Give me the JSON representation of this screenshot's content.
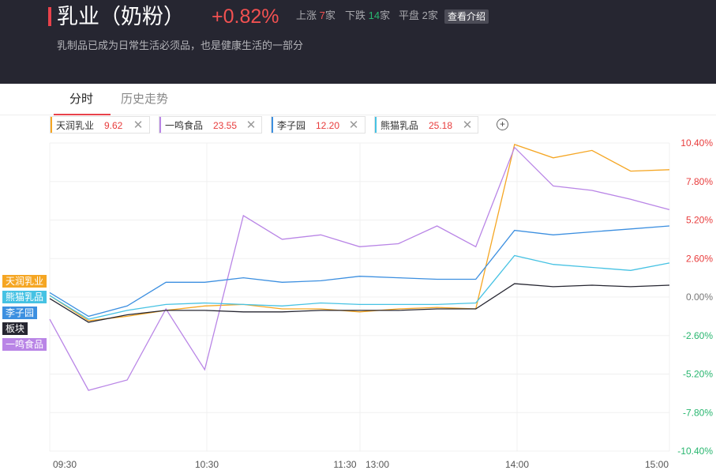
{
  "header": {
    "title": "乳业（奶粉）",
    "change": "+0.82%",
    "up_label": "上涨",
    "up_count": "7",
    "down_label": "下跌",
    "down_count": "14",
    "flat_label": "平盘",
    "flat_count": "2",
    "unit": "家",
    "intro_button": "查看介绍",
    "subtitle": "乳制品已成为日常生活必须品，也是健康生活的一部分"
  },
  "tabs": [
    {
      "label": "分时",
      "active": true
    },
    {
      "label": "历史走势",
      "active": false
    }
  ],
  "compare_chips": [
    {
      "name": "天润乳业",
      "price": "9.62",
      "color": "#f5a623"
    },
    {
      "name": "一鸣食品",
      "price": "23.55",
      "color": "#b985e6"
    },
    {
      "name": "李子园",
      "price": "12.20",
      "color": "#3c8fe0"
    },
    {
      "name": "熊猫乳品",
      "price": "25.18",
      "color": "#46c2e3"
    }
  ],
  "add_icon": "plus-circle-icon",
  "close_icon": "close-icon",
  "legend": [
    {
      "name": "天润乳业",
      "color": "#f5a623"
    },
    {
      "name": "熊猫乳品",
      "color": "#46c2e3"
    },
    {
      "name": "李子园",
      "color": "#3c8fe0"
    },
    {
      "name": "板块",
      "color": "#262631"
    },
    {
      "name": "一鸣食品",
      "color": "#b985e6"
    }
  ],
  "chart_data": {
    "type": "line",
    "x_ticks": [
      "09:30",
      "10:30",
      "11:30",
      "13:00",
      "14:00",
      "15:00"
    ],
    "y_ticks": [
      "10.40%",
      "7.80%",
      "5.20%",
      "2.60%",
      "0.00%",
      "-2.60%",
      "-5.20%",
      "-7.80%",
      "-10.40%"
    ],
    "ylim": [
      -10.4,
      10.4
    ],
    "x": [
      "09:30",
      "09:45",
      "10:00",
      "10:15",
      "10:30",
      "10:45",
      "11:00",
      "11:15",
      "11:30",
      "13:15",
      "13:30",
      "13:45",
      "14:00",
      "14:15",
      "14:30",
      "14:45",
      "15:00"
    ],
    "series": [
      {
        "name": "天润乳业",
        "color": "#f5a623",
        "values": [
          0.1,
          -1.6,
          -1.3,
          -0.9,
          -0.6,
          -0.5,
          -0.8,
          -0.8,
          -1.0,
          -0.8,
          -0.7,
          -0.8,
          10.3,
          9.4,
          9.9,
          8.5,
          8.6
        ]
      },
      {
        "name": "一鸣食品",
        "color": "#b985e6",
        "values": [
          -1.5,
          -6.3,
          -5.6,
          -0.8,
          -4.9,
          5.5,
          3.9,
          4.2,
          3.4,
          3.6,
          4.8,
          3.4,
          10.1,
          7.5,
          7.2,
          6.6,
          5.9
        ]
      },
      {
        "name": "李子园",
        "color": "#3c8fe0",
        "values": [
          0.3,
          -1.3,
          -0.6,
          1.0,
          1.0,
          1.3,
          1.0,
          1.1,
          1.4,
          1.3,
          1.2,
          1.2,
          4.5,
          4.2,
          4.4,
          4.6,
          4.8
        ]
      },
      {
        "name": "熊猫乳品",
        "color": "#46c2e3",
        "values": [
          0.1,
          -1.5,
          -0.9,
          -0.5,
          -0.4,
          -0.5,
          -0.6,
          -0.4,
          -0.5,
          -0.5,
          -0.5,
          -0.4,
          2.8,
          2.2,
          2.0,
          1.8,
          2.3
        ]
      },
      {
        "name": "板块",
        "color": "#262631",
        "values": [
          -0.1,
          -1.7,
          -1.2,
          -0.9,
          -0.9,
          -1.0,
          -1.0,
          -0.9,
          -0.9,
          -0.9,
          -0.8,
          -0.8,
          0.9,
          0.7,
          0.8,
          0.7,
          0.8
        ]
      }
    ],
    "grid": true
  }
}
